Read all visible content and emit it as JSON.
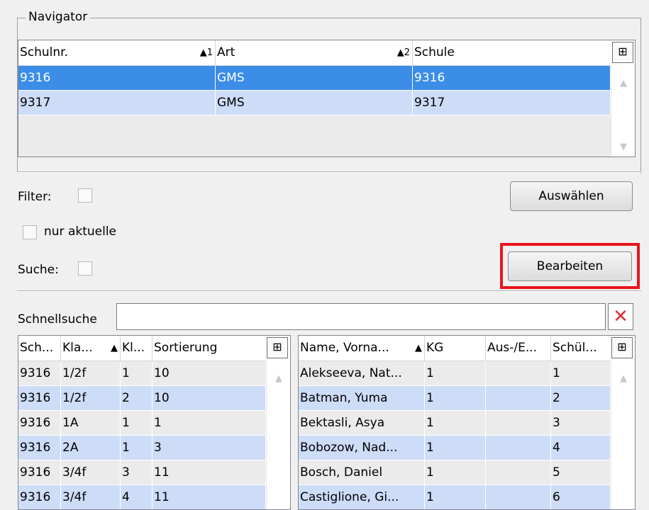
{
  "navigator": {
    "title": "Navigator",
    "columns": [
      {
        "label": "Schulnr.",
        "sort": "▲1"
      },
      {
        "label": "Art",
        "sort": "▲2"
      },
      {
        "label": "Schule",
        "sort": ""
      }
    ],
    "rows": [
      {
        "schulnr": "9316",
        "art": "GMS",
        "schule": "9316",
        "state": "selected"
      },
      {
        "schulnr": "9317",
        "art": "GMS",
        "schule": "9317",
        "state": "alt"
      }
    ],
    "column_chooser_icon": "column-chooser-icon"
  },
  "filter": {
    "filter_label": "Filter:",
    "only_current_label": "nur aktuelle",
    "search_label": "Suche:",
    "select_button": "Auswählen",
    "edit_button": "Bearbeiten"
  },
  "quicksearch": {
    "label": "Schnellsuche",
    "value": "",
    "clear_icon": "clear-x-icon"
  },
  "classes": {
    "columns": [
      {
        "label": "Sch...",
        "sort": ""
      },
      {
        "label": "Kla...",
        "sort": "▲"
      },
      {
        "label": "Kl...",
        "sort": ""
      },
      {
        "label": "Sortierung",
        "sort": ""
      }
    ],
    "rows": [
      [
        "9316",
        "1/2f",
        "1",
        "10"
      ],
      [
        "9316",
        "1/2f",
        "2",
        "10"
      ],
      [
        "9316",
        "1A",
        "1",
        "1"
      ],
      [
        "9316",
        "2A",
        "1",
        "3"
      ],
      [
        "9316",
        "3/4f",
        "3",
        "11"
      ],
      [
        "9316",
        "3/4f",
        "4",
        "11"
      ]
    ]
  },
  "students": {
    "columns": [
      {
        "label": "Name, Vorna...",
        "sort": "▲"
      },
      {
        "label": "KG",
        "sort": ""
      },
      {
        "label": "Aus-/E...",
        "sort": ""
      },
      {
        "label": "Schül...",
        "sort": ""
      }
    ],
    "rows": [
      [
        "Alekseeva, Nat...",
        "1",
        "",
        "1"
      ],
      [
        "Batman, Yuma",
        "1",
        "",
        "2"
      ],
      [
        "Bektasli, Asya",
        "1",
        "",
        "3"
      ],
      [
        "Bobozow, Nad...",
        "1",
        "",
        "4"
      ],
      [
        "Bosch, Daniel",
        "1",
        "",
        "5"
      ],
      [
        "Castiglione, Gi...",
        "1",
        "",
        "6"
      ]
    ]
  },
  "colors": {
    "selected_row": "#3b8de8",
    "alt_row": "#cddcf7",
    "plain_row": "#ebebeb",
    "highlight_frame": "#e8141c",
    "clear_icon": "#e03030"
  }
}
